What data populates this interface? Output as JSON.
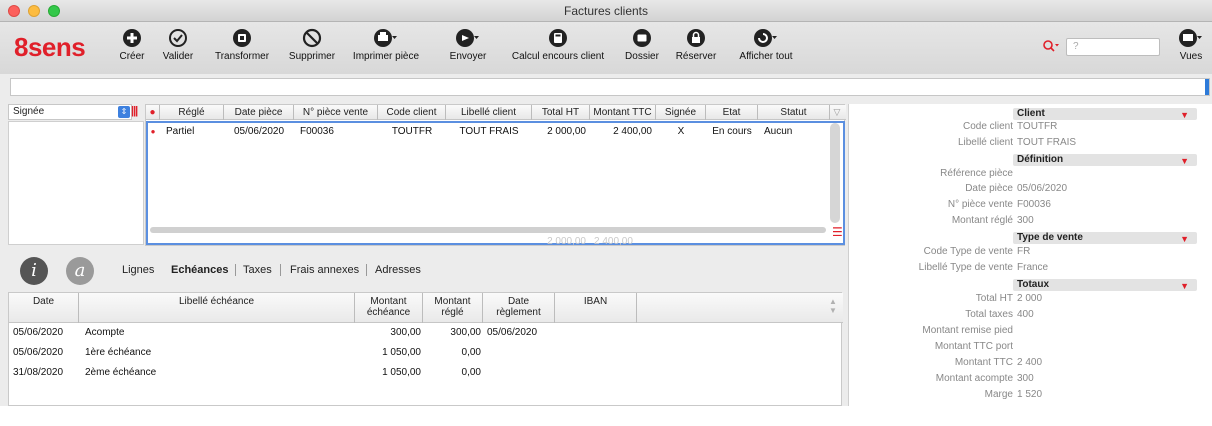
{
  "window": {
    "title": "Factures clients"
  },
  "toolbar": {
    "logo": "8sens",
    "buttons": [
      {
        "label": "Créer",
        "icon": "plus-circle-icon"
      },
      {
        "label": "Valider",
        "icon": "check-circle-icon"
      },
      {
        "label": "Transformer",
        "icon": "transform-icon"
      },
      {
        "label": "Supprimer",
        "icon": "prohibit-icon"
      },
      {
        "label": "Imprimer pièce",
        "icon": "printer-icon"
      },
      {
        "label": "Envoyer",
        "icon": "send-icon"
      },
      {
        "label": "Calcul encours client",
        "icon": "calculator-icon"
      },
      {
        "label": "Dossier",
        "icon": "folder-icon"
      },
      {
        "label": "Réserver",
        "icon": "lock-icon"
      },
      {
        "label": "Afficher tout",
        "icon": "refresh-icon"
      },
      {
        "label": "Vues",
        "icon": "views-icon"
      }
    ],
    "search_placeholder": "?"
  },
  "filter": {
    "value": ""
  },
  "state_filter": {
    "selected": "Signée"
  },
  "invoice_grid": {
    "columns": [
      "Réglé",
      "Date pièce",
      "N° pièce vente",
      "Code client",
      "Libellé client",
      "Total HT",
      "Montant TTC",
      "Signée",
      "Etat",
      "Statut"
    ],
    "rows": [
      {
        "regle": "Partiel",
        "date": "05/06/2020",
        "numero": "F00036",
        "code": "TOUTFR",
        "libelle": "TOUT FRAIS",
        "total_ht": "2 000,00",
        "ttc": "2 400,00",
        "signee": "X",
        "etat": "En cours",
        "statut": "Aucun"
      }
    ],
    "totals": {
      "total_ht": "2 000,00",
      "ttc": "2 400,00"
    }
  },
  "tabs": [
    {
      "label": "Lignes",
      "active": false
    },
    {
      "label": "Echéances",
      "active": true
    },
    {
      "label": "Taxes",
      "active": false
    },
    {
      "label": "Frais annexes",
      "active": false
    },
    {
      "label": "Adresses",
      "active": false
    }
  ],
  "info_buttons": {
    "info": "i",
    "about": "a"
  },
  "echeances_grid": {
    "columns": {
      "date": "Date",
      "libelle": "Libellé échéance",
      "montant_ech_1": "Montant",
      "montant_ech_2": "échéance",
      "montant_reg_1": "Montant",
      "montant_reg_2": "réglé",
      "date_reg_1": "Date",
      "date_reg_2": "règlement",
      "iban": "IBAN"
    },
    "rows": [
      {
        "date": "05/06/2020",
        "libelle": "Acompte",
        "montant": "300,00",
        "regle": "300,00",
        "date_reglement": "05/06/2020"
      },
      {
        "date": "05/06/2020",
        "libelle": "1ère échéance",
        "montant": "1 050,00",
        "regle": "0,00",
        "date_reglement": ""
      },
      {
        "date": "31/08/2020",
        "libelle": "2ème échéance",
        "montant": "1 050,00",
        "regle": "0,00",
        "date_reglement": ""
      }
    ]
  },
  "details": {
    "client": {
      "title": "Client",
      "code_client_label": "Code client",
      "code_client": "TOUTFR",
      "libelle_client_label": "Libellé client",
      "libelle_client": "TOUT FRAIS"
    },
    "definition": {
      "title": "Définition",
      "reference_label": "Référence pièce",
      "reference": "",
      "date_label": "Date pièce",
      "date": "05/06/2020",
      "numero_label": "N° pièce vente",
      "numero": "F00036",
      "montant_regle_label": "Montant réglé",
      "montant_regle": "300"
    },
    "type_vente": {
      "title": "Type de vente",
      "code_label": "Code Type de vente",
      "code": "FR",
      "libelle_label": "Libellé Type de vente",
      "libelle": "France"
    },
    "totaux": {
      "title": "Totaux",
      "total_ht_label": "Total HT",
      "total_ht": "2 000",
      "total_taxes_label": "Total taxes",
      "total_taxes": "400",
      "remise_label": "Montant remise pied",
      "remise": "",
      "ttc_port_label": "Montant TTC port",
      "ttc_port": "",
      "ttc_label": "Montant TTC",
      "ttc": "2 400",
      "acompte_label": "Montant acompte",
      "acompte": "300",
      "marge_label": "Marge",
      "marge": "1 520"
    }
  },
  "colors": {
    "brand": "#e0202a",
    "selection": "#5b8fe0",
    "accent": "#2e7bd9"
  }
}
